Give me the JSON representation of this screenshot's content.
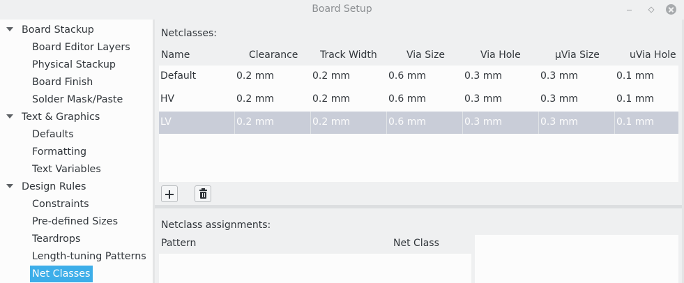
{
  "window": {
    "title": "Board Setup"
  },
  "sidebar": {
    "groups": [
      {
        "label": "Board Stackup",
        "children": [
          "Board Editor Layers",
          "Physical Stackup",
          "Board Finish",
          "Solder Mask/Paste"
        ]
      },
      {
        "label": "Text & Graphics",
        "children": [
          "Defaults",
          "Formatting",
          "Text Variables"
        ]
      },
      {
        "label": "Design Rules",
        "children": [
          "Constraints",
          "Pre-defined Sizes",
          "Teardrops",
          "Length-tuning Patterns",
          "Net Classes"
        ]
      }
    ],
    "selected": "Net Classes"
  },
  "netclasses": {
    "label": "Netclasses:",
    "columns": [
      "Name",
      "Clearance",
      "Track Width",
      "Via Size",
      "Via Hole",
      "μVia Size",
      "uVia Hole"
    ],
    "rows": [
      [
        "Default",
        "0.2 mm",
        "0.2 mm",
        "0.6 mm",
        "0.3 mm",
        "0.3 mm",
        "0.1 mm"
      ],
      [
        "HV",
        "0.2 mm",
        "0.2 mm",
        "0.6 mm",
        "0.3 mm",
        "0.3 mm",
        "0.1 mm"
      ],
      [
        "LV",
        "0.2 mm",
        "0.2 mm",
        "0.6 mm",
        "0.3 mm",
        "0.3 mm",
        "0.1 mm"
      ]
    ],
    "selected_row": 2
  },
  "assignments": {
    "label": "Netclass assignments:",
    "columns": [
      "Pattern",
      "Net Class"
    ]
  },
  "icons": {
    "add": "plus-icon",
    "delete": "trash-icon",
    "tree_expand": "chevron-down-icon"
  },
  "colors": {
    "selection_accent": "#3daee9",
    "row_selection": "#c9cdd8"
  }
}
